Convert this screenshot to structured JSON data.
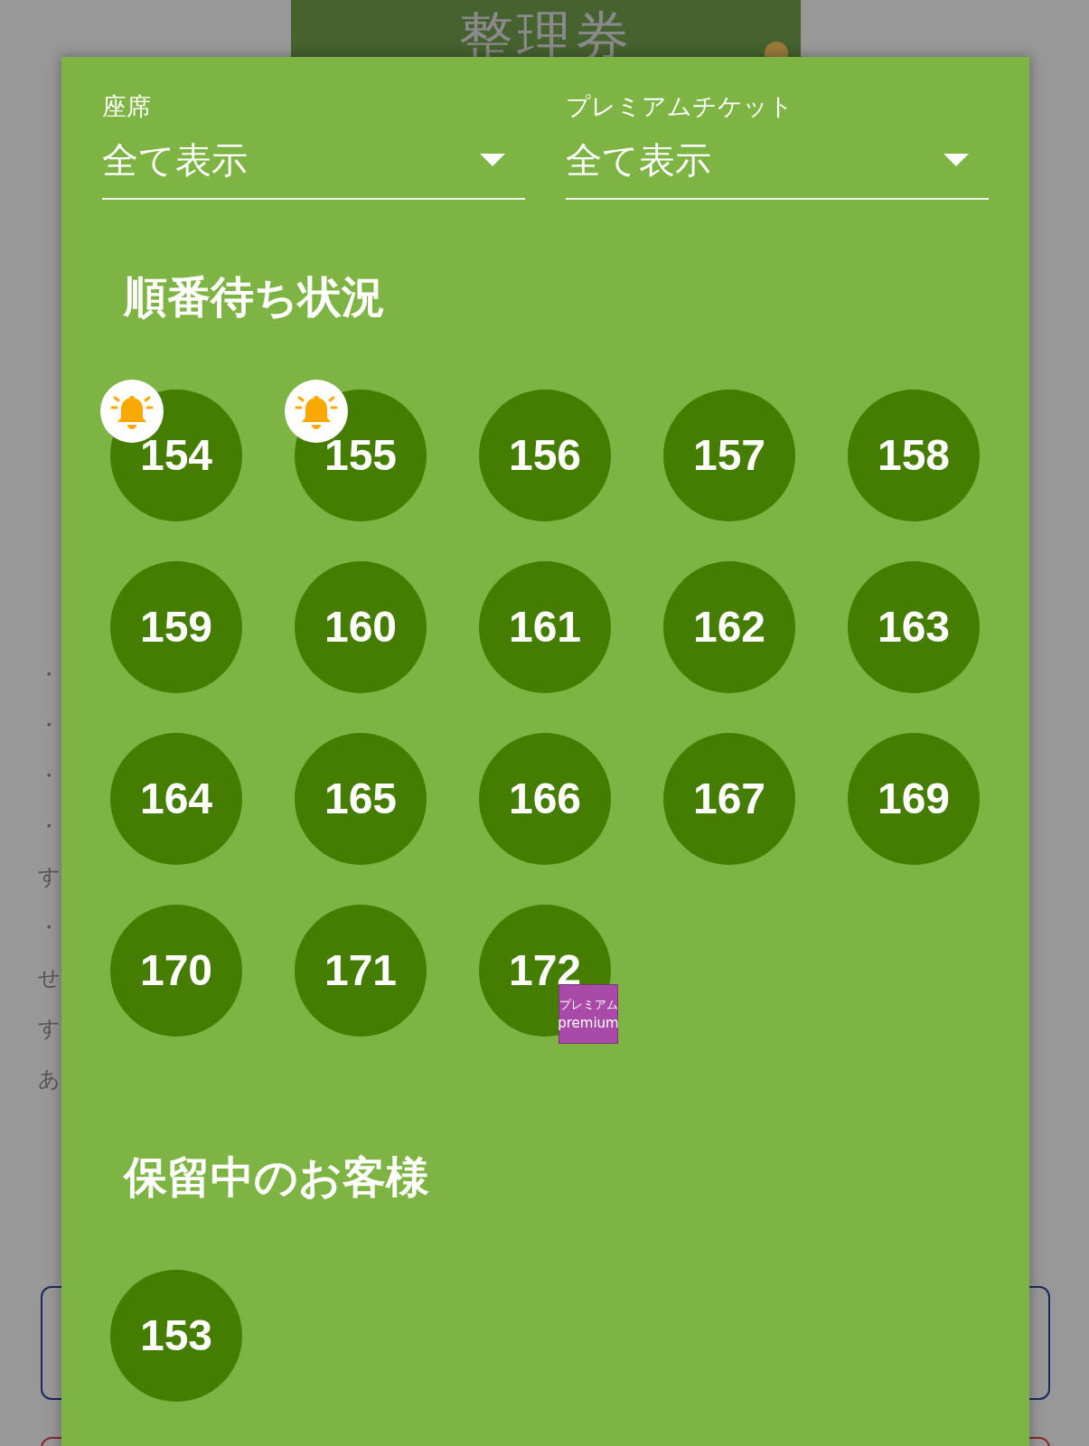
{
  "background_page": {
    "title": "整理券",
    "fragments": [
      "・",
      "・",
      "・",
      "・",
      "す",
      "・",
      "せ",
      "す",
      "あ"
    ]
  },
  "filters": [
    {
      "label": "座席",
      "value": "全て表示"
    },
    {
      "label": "プレミアムチケット",
      "value": "全て表示"
    }
  ],
  "sections": [
    {
      "title": "順番待ち状況",
      "tickets": [
        {
          "number": "154",
          "notified": true,
          "premium": false
        },
        {
          "number": "155",
          "notified": true,
          "premium": false
        },
        {
          "number": "156",
          "notified": false,
          "premium": false
        },
        {
          "number": "157",
          "notified": false,
          "premium": false
        },
        {
          "number": "158",
          "notified": false,
          "premium": false
        },
        {
          "number": "159",
          "notified": false,
          "premium": false
        },
        {
          "number": "160",
          "notified": false,
          "premium": false
        },
        {
          "number": "161",
          "notified": false,
          "premium": false
        },
        {
          "number": "162",
          "notified": false,
          "premium": false
        },
        {
          "number": "163",
          "notified": false,
          "premium": false
        },
        {
          "number": "164",
          "notified": false,
          "premium": false
        },
        {
          "number": "165",
          "notified": false,
          "premium": false
        },
        {
          "number": "166",
          "notified": false,
          "premium": false
        },
        {
          "number": "167",
          "notified": false,
          "premium": false
        },
        {
          "number": "169",
          "notified": false,
          "premium": false
        },
        {
          "number": "170",
          "notified": false,
          "premium": false
        },
        {
          "number": "171",
          "notified": false,
          "premium": false
        },
        {
          "number": "172",
          "notified": false,
          "premium": true
        }
      ]
    },
    {
      "title": "保留中のお客様",
      "tickets": [
        {
          "number": "153",
          "notified": false,
          "premium": false
        }
      ]
    }
  ],
  "premium_badge": {
    "label_ja": "プレミアム",
    "label_en": "premium"
  }
}
